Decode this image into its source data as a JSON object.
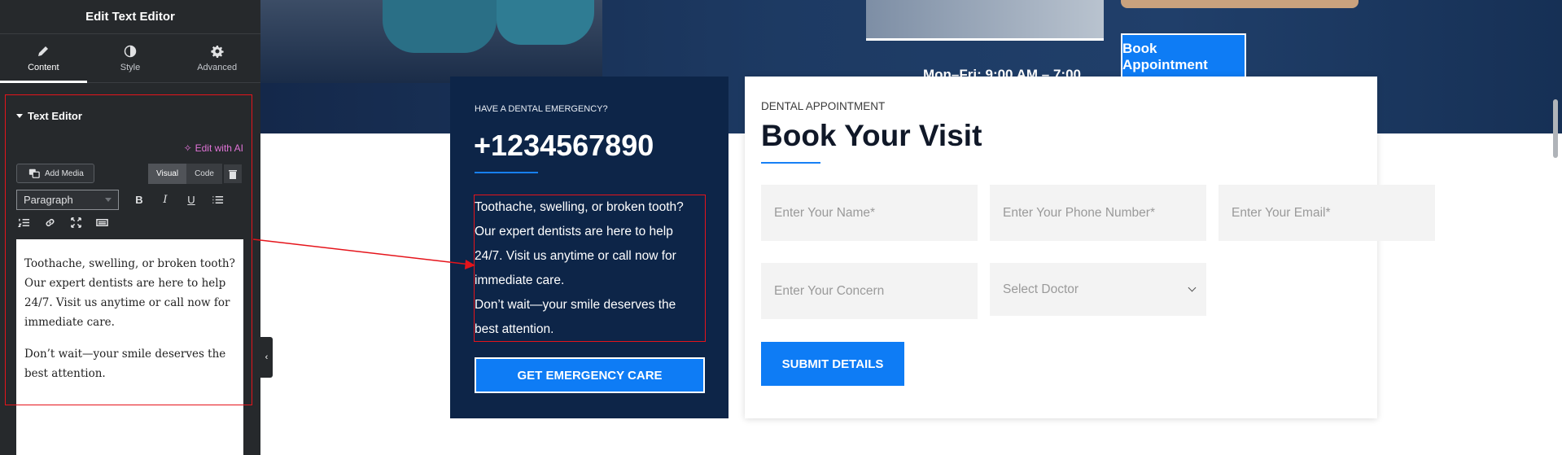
{
  "panel": {
    "title": "Edit Text Editor",
    "tabs": [
      {
        "label": "Content",
        "icon": "pencil-icon",
        "active": true
      },
      {
        "label": "Style",
        "icon": "contrast-icon",
        "active": false
      },
      {
        "label": "Advanced",
        "icon": "gear-icon",
        "active": false
      }
    ],
    "section_title": "Text Editor",
    "edit_with_ai": "Edit with AI",
    "add_media": "Add Media",
    "visual_tab": "Visual",
    "code_tab": "Code",
    "format_value": "Paragraph",
    "editor_paragraphs": [
      "Toothache, swelling, or broken tooth? Our expert dentists are here to help 24/7. Visit us anytime or call now for immediate care.",
      "Don’t wait—your smile deserves the best attention."
    ]
  },
  "hero": {
    "hours": "Mon–Fri: 9:00 AM – 7:00",
    "book_button": "Book Appointment"
  },
  "emergency": {
    "label": "HAVE A DENTAL EMERGENCY?",
    "phone": "+1234567890",
    "text_lines": [
      "Toothache, swelling, or broken tooth?",
      "Our expert dentists are here to help",
      "24/7. Visit us anytime or call now for",
      "immediate care.",
      "Don’t wait—your smile deserves the",
      "best attention."
    ],
    "button": "GET EMERGENCY CARE"
  },
  "appointment": {
    "label": "DENTAL APPOINTMENT",
    "title": "Book Your Visit",
    "fields": {
      "name": "Enter Your Name*",
      "phone": "Enter Your Phone Number*",
      "email": "Enter Your Email*",
      "concern": "Enter Your Concern",
      "doctor": "Select Doctor"
    },
    "submit": "SUBMIT DETAILS"
  },
  "colors": {
    "accent": "#0e7cf5",
    "panel_bg": "#26292c",
    "emergency_bg": "#0d2548",
    "annotation_red": "#e5141b",
    "ai_pink": "#e073d7"
  }
}
